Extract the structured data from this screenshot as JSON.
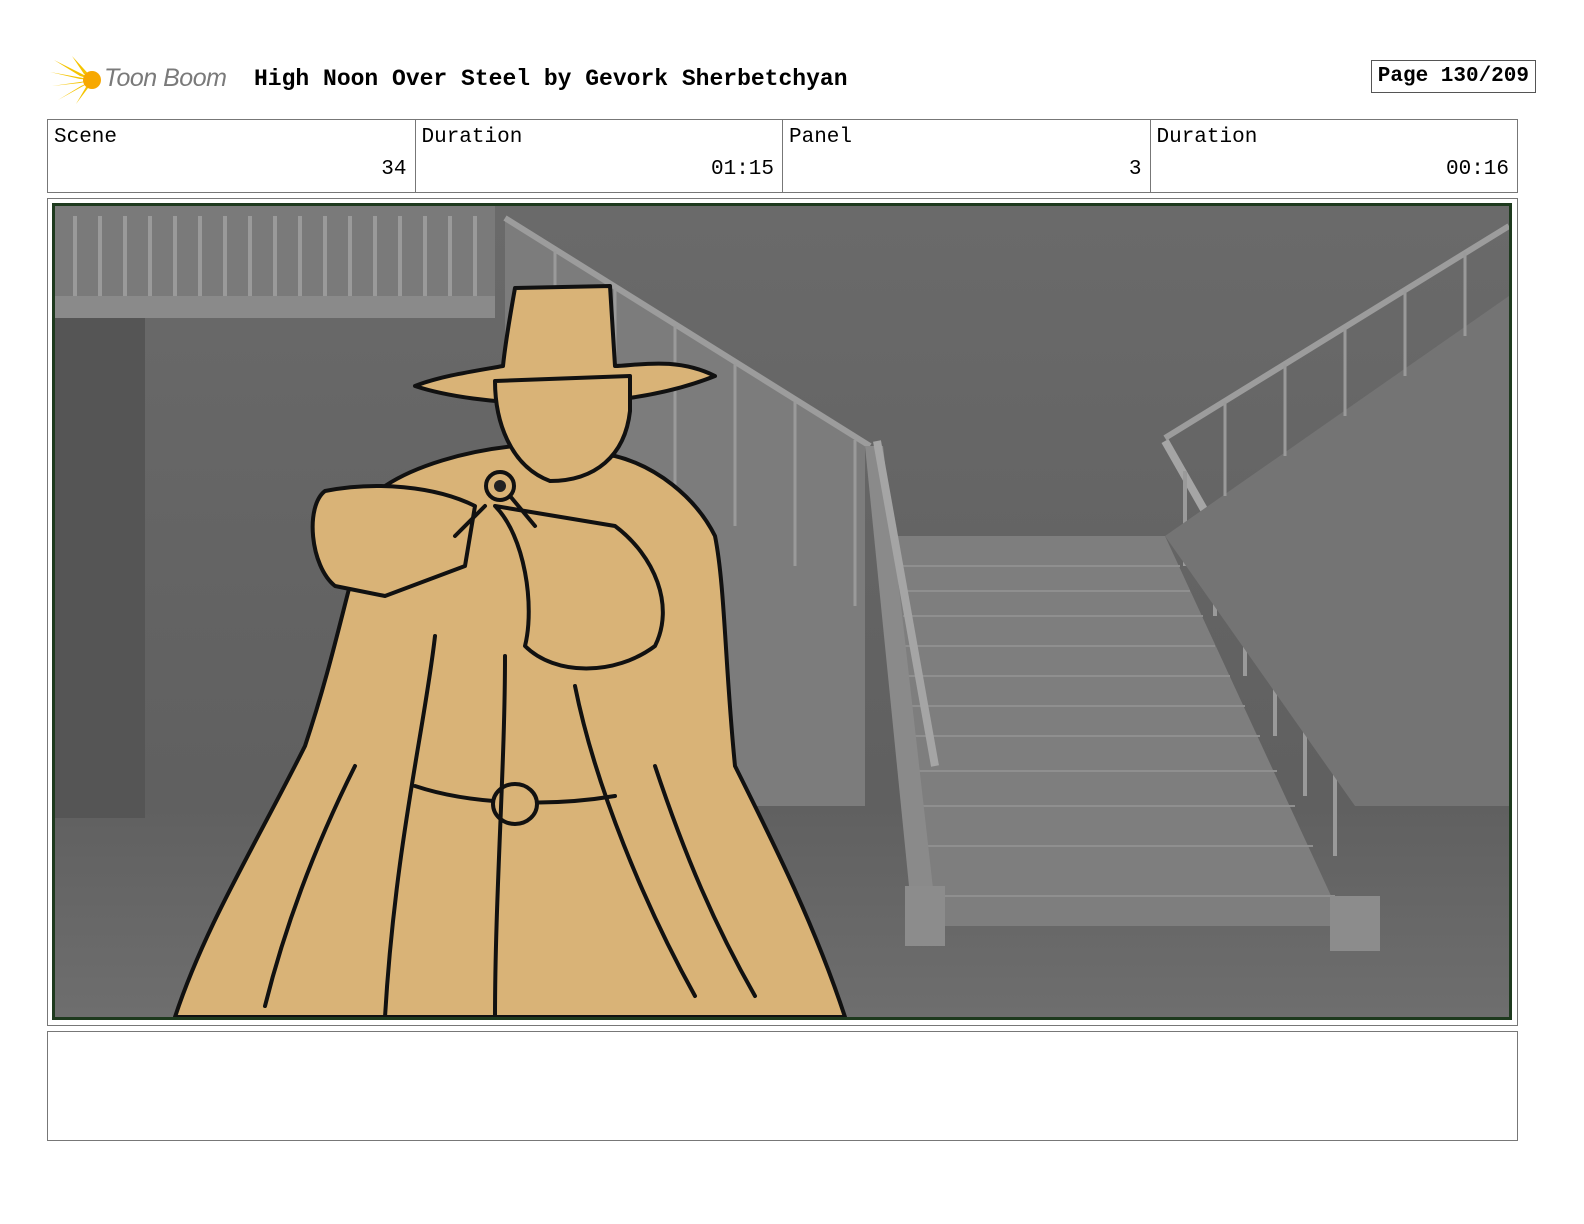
{
  "header": {
    "logo_text": "Toon Boom",
    "title": "High Noon Over Steel by Gevork Sherbetchyan",
    "page": "Page 130/209"
  },
  "info": {
    "scene_label": "Scene",
    "scene_value": "34",
    "scene_duration_label": "Duration",
    "scene_duration_value": "01:15",
    "panel_label": "Panel",
    "panel_value": "3",
    "panel_duration_label": "Duration",
    "panel_duration_value": "00:16"
  },
  "notes": {
    "text": ""
  },
  "colors": {
    "figure_fill": "#d9b377",
    "background_gray": "#707070",
    "panel_border": "#1e3a1e",
    "logo_accent": "#f5c400"
  }
}
